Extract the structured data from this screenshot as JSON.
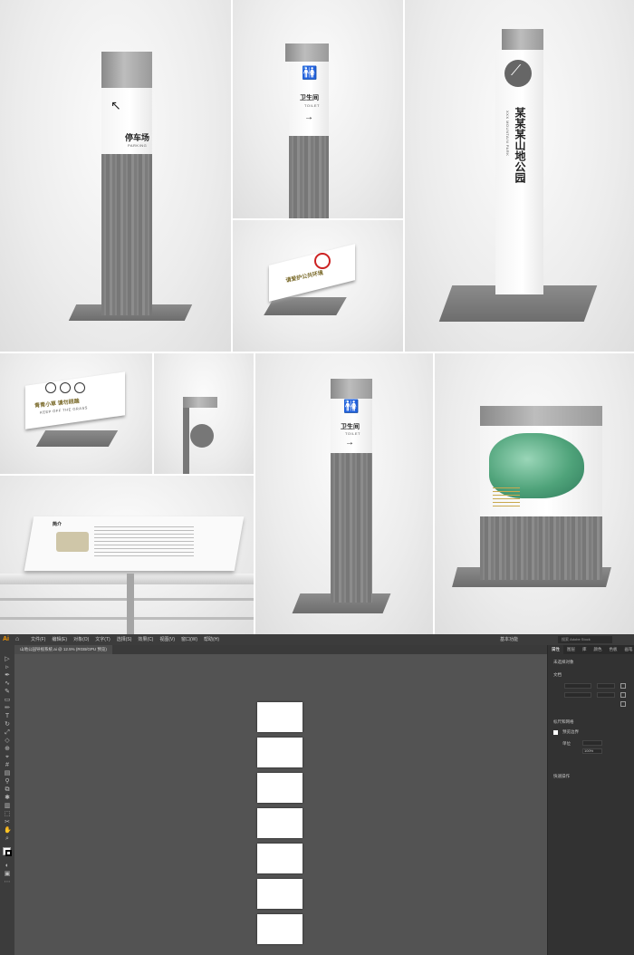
{
  "mockups": {
    "parking_sign": {
      "title": "停车场",
      "subtitle": "PARKING",
      "arrow": "↖"
    },
    "toilet_sign_small": {
      "title": "卫生间",
      "subtitle": "TOILET",
      "arrow": "→"
    },
    "park_name_sign": {
      "title": "某某某山地公园",
      "subtitle": "XXX MOUNTAIN PARK"
    },
    "care_sign": {
      "text": "请爱护公共环境"
    },
    "grass_sign": {
      "text": "青青小草 请勿践踏",
      "subtitle": "KEEP OFF THE GRASS"
    },
    "toilet_sign_tall": {
      "title": "卫生间",
      "subtitle": "TOILET",
      "arrow": "→"
    },
    "rail_sign": {
      "title": "简介"
    }
  },
  "app": {
    "logo": "Ai",
    "menu": [
      "文件(F)",
      "编辑(E)",
      "对象(O)",
      "文字(T)",
      "选择(S)",
      "效果(C)",
      "视图(V)",
      "窗口(W)",
      "帮助(H)"
    ],
    "workspace": "基本功能",
    "search_placeholder": "搜索 Adobe Stock",
    "document_tab": "山地公园导视系统.ai @ 12.5% (RGB/GPU 预览)"
  },
  "properties_panel": {
    "tabs": [
      "属性",
      "图层",
      "库",
      "颜色",
      "色板",
      "画笔"
    ],
    "section_no_selection": "未选择对象",
    "section_document": "文档",
    "section_rulers": "标尺和网格",
    "checkbox_label": "预览边界",
    "unit_label": "单位",
    "zoom_value": "100%",
    "quick_actions": "快速操作"
  },
  "colors": {
    "accent": "#ff9a00",
    "chrome": "#3c3c3c",
    "canvas": "#535353",
    "panel": "#323232"
  }
}
